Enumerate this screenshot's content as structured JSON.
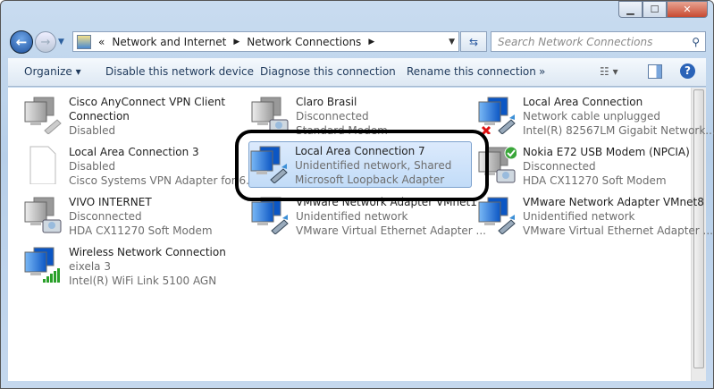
{
  "window": {
    "minimize": "▁",
    "maximize": "☐",
    "close": "✕"
  },
  "address": {
    "prefix": "«",
    "crumbs": [
      "Network and Internet",
      "Network Connections"
    ],
    "search_placeholder": "Search Network Connections"
  },
  "toolbar": {
    "organize": "Organize ▾",
    "disable": "Disable this network device",
    "diagnose": "Diagnose this connection",
    "rename": "Rename this connection",
    "more": "»"
  },
  "connections": [
    {
      "name": "Cisco AnyConnect VPN Client Connection",
      "status": "Disabled",
      "device": "",
      "icon": "network-disabled"
    },
    {
      "name": "Claro Brasil",
      "status": "Disconnected",
      "device": "Standard Modem",
      "icon": "modem"
    },
    {
      "name": "Local Area Connection",
      "status": "Network cable unplugged",
      "device": "Intel(R) 82567LM Gigabit Network...",
      "icon": "ethernet-unplugged"
    },
    {
      "name": "Local Area Connection 3",
      "status": "Disabled",
      "device": "Cisco Systems VPN Adapter for 6...",
      "icon": "blank"
    },
    {
      "name": "Local Area Connection 7",
      "status": "Unidentified network, Shared",
      "device": "Microsoft Loopback Adapter",
      "icon": "ethernet",
      "selected": true
    },
    {
      "name": "Nokia E72 USB Modem (NPCIA)",
      "status": "Disconnected",
      "device": "HDA CX11270 Soft Modem",
      "icon": "modem-default"
    },
    {
      "name": "VIVO INTERNET",
      "status": "Disconnected",
      "device": "HDA CX11270 Soft Modem",
      "icon": "modem"
    },
    {
      "name": "VMware Network Adapter VMnet1",
      "status": "Unidentified network",
      "device": "VMware Virtual Ethernet Adapter ...",
      "icon": "ethernet"
    },
    {
      "name": "VMware Network Adapter VMnet8",
      "status": "Unidentified network",
      "device": "VMware Virtual Ethernet Adapter ...",
      "icon": "ethernet"
    },
    {
      "name": "Wireless Network Connection",
      "status": "eixela  3",
      "device": "Intel(R) WiFi Link 5100 AGN",
      "icon": "wireless"
    }
  ]
}
